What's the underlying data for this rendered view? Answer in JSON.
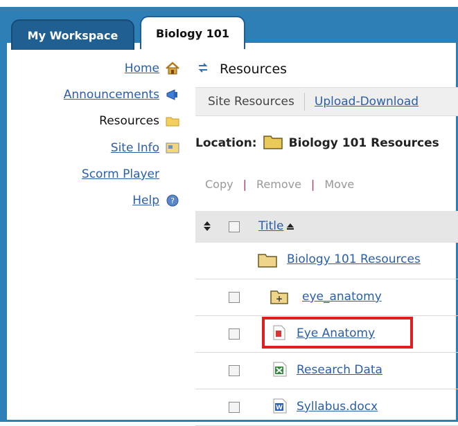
{
  "tabs": {
    "inactive_label": "My Workspace",
    "active_label": "Biology 101"
  },
  "sidebar": {
    "items": [
      {
        "label": "Home",
        "icon": "home-icon"
      },
      {
        "label": "Announcements",
        "icon": "megaphone-icon"
      },
      {
        "label": "Resources",
        "icon": "folder-icon"
      },
      {
        "label": "Site Info",
        "icon": "info-icon"
      },
      {
        "label": "Scorm Player",
        "icon": ""
      },
      {
        "label": "Help",
        "icon": "help-icon"
      }
    ]
  },
  "main": {
    "title": "Resources",
    "subnav": {
      "site_resources": "Site Resources",
      "upload_download": "Upload-Download"
    },
    "location_label": "Location:",
    "location_value": "Biology 101 Resources",
    "actions": {
      "copy": "Copy",
      "remove": "Remove",
      "move": "Move",
      "separator": "|"
    },
    "table": {
      "header_title": "Title",
      "rows": [
        {
          "name": "Biology 101 Resources",
          "type": "folder-root"
        },
        {
          "name": "eye_anatomy",
          "type": "folder"
        },
        {
          "name": "Eye Anatomy",
          "type": "pdf"
        },
        {
          "name": "Research Data",
          "type": "excel"
        },
        {
          "name": "Syllabus.docx",
          "type": "word"
        }
      ]
    }
  },
  "colors": {
    "frame_blue": "#2e7fb6",
    "link_blue": "#2a5ea8",
    "highlight_red": "#e11d1d"
  }
}
